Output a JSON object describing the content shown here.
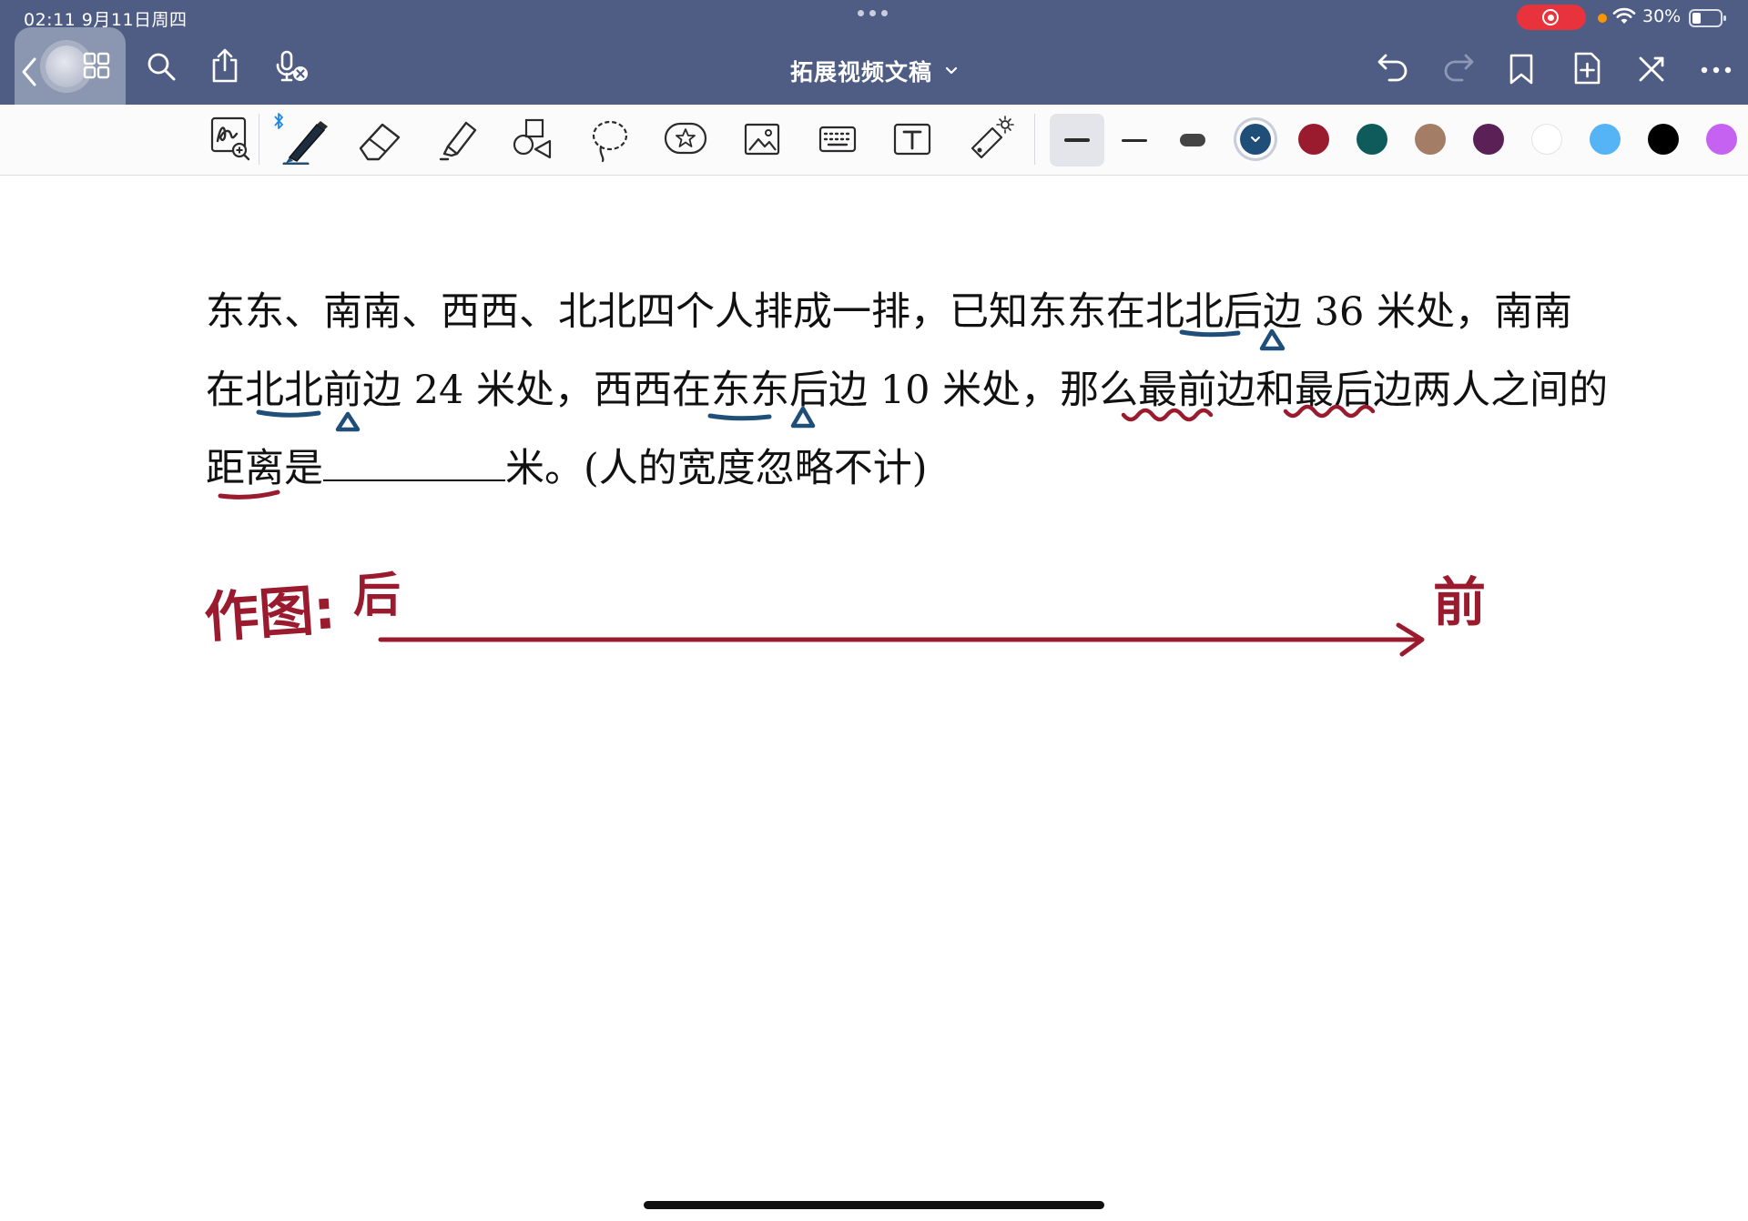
{
  "status_bar": {
    "time_date": "02:11  9月11日周四",
    "battery": "30%"
  },
  "nav": {
    "doc_title": "拓展视频文稿"
  },
  "toolbar": {
    "pen_colors": [
      "#1f4e79",
      "#9b1b2e",
      "#0f5b5b",
      "#a37d65",
      "#5b2157",
      "#ffffff",
      "#54b4f5",
      "#000000",
      "#c562f2"
    ],
    "selected_color_index": 0
  },
  "problem": {
    "line1": "东东、南南、西西、北北四个人排成一排，已知东东在北北后边 36 米处，南南",
    "line2": "在北北前边 24 米处，西西在东东后边 10 米处，那么最前边和最后边两人之间的",
    "line3_prefix": "距离是",
    "line3_suffix": "米。(人的宽度忽略不计)"
  },
  "handwriting": {
    "draw_label": "作图:",
    "back_label": "后",
    "front_label": "前"
  }
}
